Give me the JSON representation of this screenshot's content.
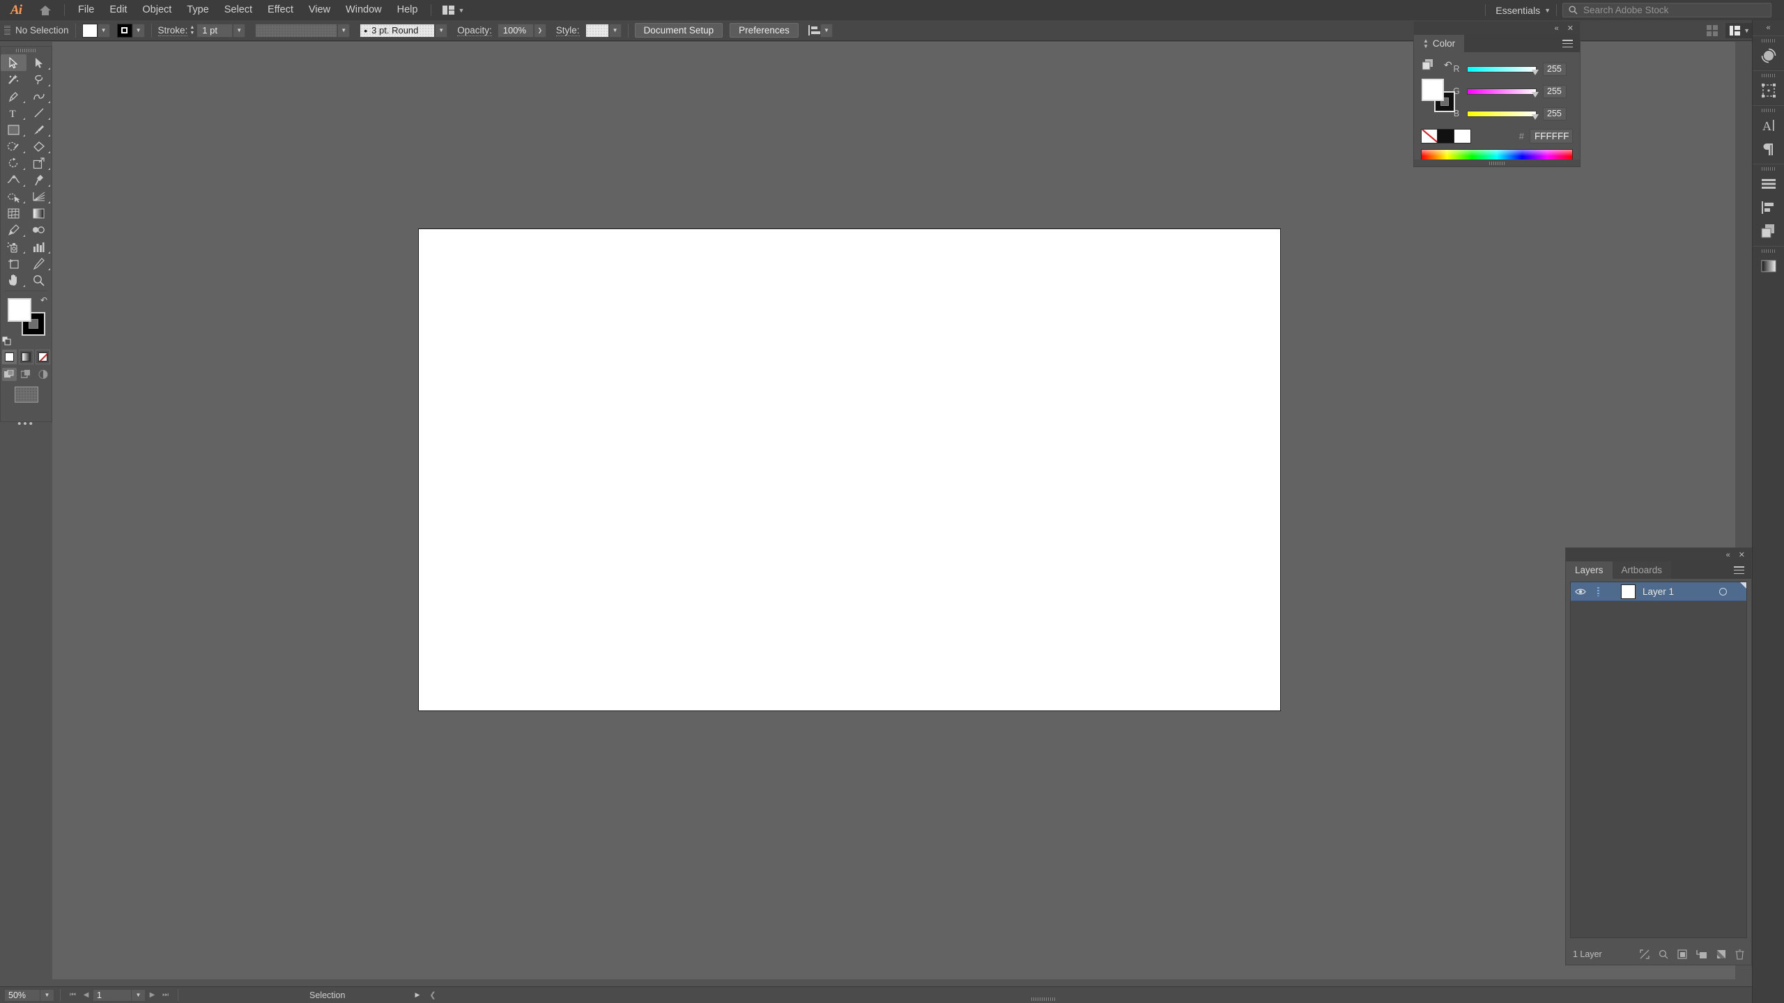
{
  "app": {
    "logo_text": "Ai",
    "home_icon": "home-icon"
  },
  "menubar": {
    "items": [
      "File",
      "Edit",
      "Object",
      "Type",
      "Select",
      "Effect",
      "View",
      "Window",
      "Help"
    ],
    "arrange_icon": "arrange-documents-icon",
    "workspace": "Essentials",
    "search_placeholder": "Search Adobe Stock"
  },
  "controlbar": {
    "selection_status": "No Selection",
    "fill_label": "fill-swatch",
    "stroke_swatch_label": "stroke-swatch",
    "stroke_label": "Stroke:",
    "stroke_weight": "1 pt",
    "stroke_profile": "3 pt. Round",
    "opacity_label": "Opacity:",
    "opacity_value": "100%",
    "style_label": "Style:",
    "document_setup": "Document Setup",
    "preferences": "Preferences",
    "align_icon": "align-icon",
    "arrange_icon": "arrange-icon",
    "options_icon": "more-options-icon"
  },
  "toolbar": {
    "tools": [
      {
        "name": "selection-tool",
        "active": true
      },
      {
        "name": "direct-selection-tool",
        "active": false
      },
      {
        "name": "magic-wand-tool",
        "active": false
      },
      {
        "name": "lasso-tool",
        "active": false
      },
      {
        "name": "pen-tool",
        "active": false
      },
      {
        "name": "curvature-tool",
        "active": false
      },
      {
        "name": "type-tool",
        "active": false
      },
      {
        "name": "line-segment-tool",
        "active": false
      },
      {
        "name": "rectangle-tool",
        "active": false
      },
      {
        "name": "paintbrush-tool",
        "active": false
      },
      {
        "name": "shaper-tool",
        "active": false
      },
      {
        "name": "eraser-tool",
        "active": false
      },
      {
        "name": "rotate-tool",
        "active": false
      },
      {
        "name": "scale-tool",
        "active": false
      },
      {
        "name": "width-tool",
        "active": false
      },
      {
        "name": "free-transform-tool",
        "active": false
      },
      {
        "name": "shape-builder-tool",
        "active": false
      },
      {
        "name": "perspective-grid-tool",
        "active": false
      },
      {
        "name": "mesh-tool",
        "active": false
      },
      {
        "name": "gradient-tool",
        "active": false
      },
      {
        "name": "eyedropper-tool",
        "active": false
      },
      {
        "name": "blend-tool",
        "active": false
      },
      {
        "name": "symbol-sprayer-tool",
        "active": false
      },
      {
        "name": "column-graph-tool",
        "active": false
      },
      {
        "name": "artboard-tool",
        "active": false
      },
      {
        "name": "slice-tool",
        "active": false
      },
      {
        "name": "hand-tool",
        "active": false
      },
      {
        "name": "zoom-tool",
        "active": false
      }
    ],
    "fill_color": "#ffffff",
    "stroke_color": "#000000",
    "color_modes": [
      "color-fill-mode",
      "gradient-fill-mode",
      "none-fill-mode"
    ],
    "draw_modes": [
      "draw-normal-mode",
      "draw-behind-mode",
      "draw-inside-mode"
    ],
    "screen_mode": "change-screen-mode",
    "more_tools": "edit-toolbar-icon"
  },
  "color_panel": {
    "tab_label": "Color",
    "channels": [
      {
        "label": "R",
        "value": "255"
      },
      {
        "label": "G",
        "value": "255"
      },
      {
        "label": "B",
        "value": "255"
      }
    ],
    "hex_sign": "#",
    "hex_value": "FFFFFF",
    "fill_color": "#ffffff",
    "stroke_color": "#000000",
    "swatches": [
      "none-swatch",
      "black-swatch",
      "white-swatch"
    ],
    "collapse_icon": "collapse-panel-icon",
    "close_icon": "close-panel-icon",
    "menu_icon": "panel-menu-icon"
  },
  "layers_panel": {
    "tabs": [
      {
        "label": "Layers",
        "active": true
      },
      {
        "label": "Artboards",
        "active": false
      }
    ],
    "rows": [
      {
        "name": "Layer 1",
        "visible": true,
        "thumb_color": "#ffffff",
        "selected": true
      }
    ],
    "footer_count": "1 Layer",
    "footer_icons": [
      "locate-object-icon",
      "make-clipping-mask-icon",
      "create-new-sublayer-icon",
      "create-new-layer-icon",
      "delete-selection-icon"
    ],
    "collapse_icon": "collapse-panel-icon",
    "close_icon": "close-panel-icon",
    "menu_icon": "panel-menu-icon"
  },
  "right_dock": {
    "collapse_icon": "collapse-dock-icon",
    "items": [
      "color-guide-icon",
      "properties-transform-icon",
      "character-icon",
      "paragraph-icon",
      "align-icon",
      "align-objects-icon",
      "pathfinder-icon",
      "gradient-icon"
    ]
  },
  "statusbar": {
    "zoom_level": "50%",
    "first_artboard_icon": "first-artboard-icon",
    "prev_artboard_icon": "previous-artboard-icon",
    "artboard_number": "1",
    "next_artboard_icon": "next-artboard-icon",
    "last_artboard_icon": "last-artboard-icon",
    "status_text": "Selection",
    "play_icon": "play-icon",
    "chevron_icon": "chevron-left-icon"
  },
  "canvas": {
    "artboard_fill": "#ffffff"
  }
}
